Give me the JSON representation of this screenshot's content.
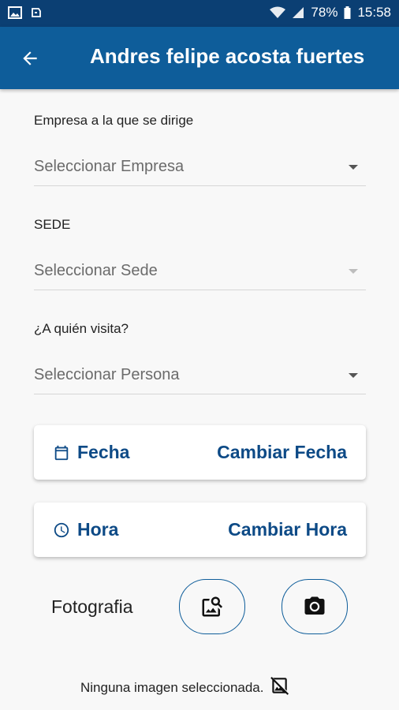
{
  "status_bar": {
    "battery": "78%",
    "time": "15:58"
  },
  "app_bar": {
    "title": "Andres felipe acosta fuertes"
  },
  "form": {
    "empresa": {
      "label": "Empresa a la que se dirige",
      "value": "Seleccionar Empresa"
    },
    "sede": {
      "label": "SEDE",
      "value": "Seleccionar Sede"
    },
    "persona": {
      "label": "¿A quién visita?",
      "value": "Seleccionar Persona"
    }
  },
  "fecha_card": {
    "label": "Fecha",
    "action": "Cambiar Fecha"
  },
  "hora_card": {
    "label": "Hora",
    "action": "Cambiar Hora"
  },
  "photo": {
    "label": "Fotografia",
    "no_image_text": "Ninguna imagen seleccionada."
  },
  "colors": {
    "status_bar": "#0b3f73",
    "app_bar": "#0e5d9a",
    "accent_text": "#0d4a86",
    "background": "#f8f8f8"
  },
  "icons": {
    "back": "arrow-left-icon",
    "calendar": "calendar-icon",
    "clock": "clock-icon",
    "gallery": "image-search-icon",
    "camera": "camera-icon",
    "no_image": "hide-image-icon"
  }
}
